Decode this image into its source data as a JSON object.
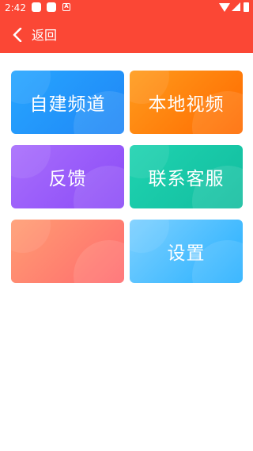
{
  "status_bar": {
    "time": "2:42",
    "notification_badge": "A"
  },
  "app_bar": {
    "back_label": "返回",
    "color": "#fb4735"
  },
  "tiles": [
    {
      "label": "自建频道"
    },
    {
      "label": "本地视频"
    },
    {
      "label": "反馈"
    },
    {
      "label": "联系客服"
    },
    {
      "label": ""
    },
    {
      "label": "设置"
    }
  ]
}
